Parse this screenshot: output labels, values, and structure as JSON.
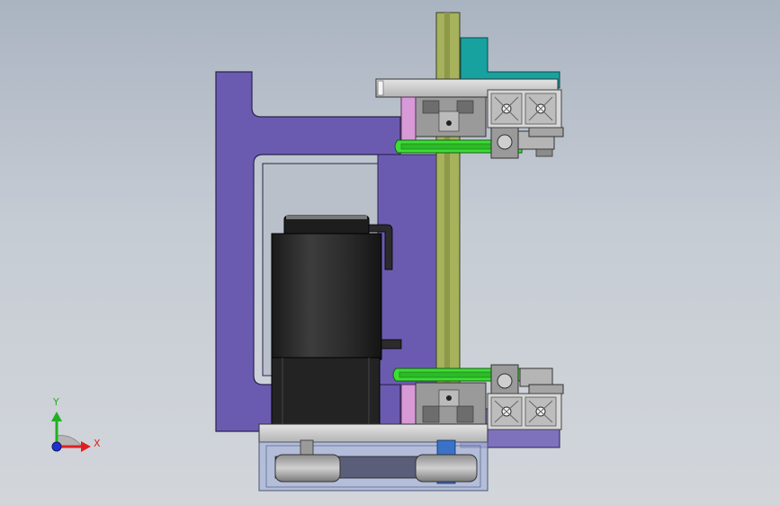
{
  "triad": {
    "y_label": "Y",
    "x_label": "X",
    "colors": {
      "x": "#e02020",
      "y": "#22b022",
      "z": "#2030d0"
    }
  },
  "colors": {
    "frame": "#6b5bb0",
    "frame_edge": "#2a2350",
    "rail": "#a6b25c",
    "bracket": "#17a2a0",
    "belt": "#3ddd36",
    "pink_spacer": "#d79ad6",
    "motor": "#2d2d2d",
    "plate": "#c9c9c9",
    "profile": "#d7d7d7",
    "housing": "#aab6d8",
    "shaft": "#3a72c8"
  }
}
